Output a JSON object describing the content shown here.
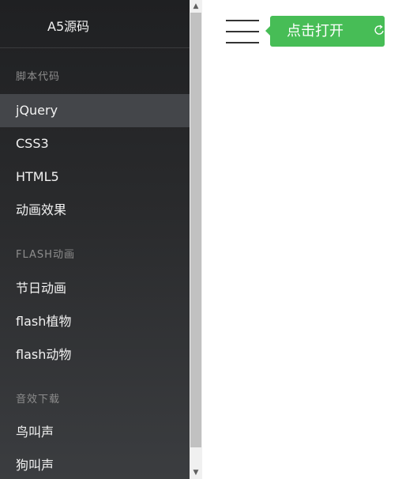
{
  "sidebar": {
    "brand": "A5源码",
    "sections": [
      {
        "label": "脚本代码",
        "items": [
          "jQuery",
          "CSS3",
          "HTML5",
          "动画效果"
        ]
      },
      {
        "label": "FLASH动画",
        "items": [
          "节日动画",
          "flash植物",
          "flash动物"
        ]
      },
      {
        "label": "音效下载",
        "items": [
          "鸟叫声",
          "狗叫声"
        ]
      }
    ]
  },
  "main": {
    "tooltip_text": "点击打开"
  },
  "icons": {
    "menu": "hamburger-menu-icon",
    "tooltip_extra": "refresh-icon"
  },
  "colors": {
    "accent": "#47bd56",
    "sidebar_bg": "#2a2b2d",
    "active_item": "#44464a"
  }
}
